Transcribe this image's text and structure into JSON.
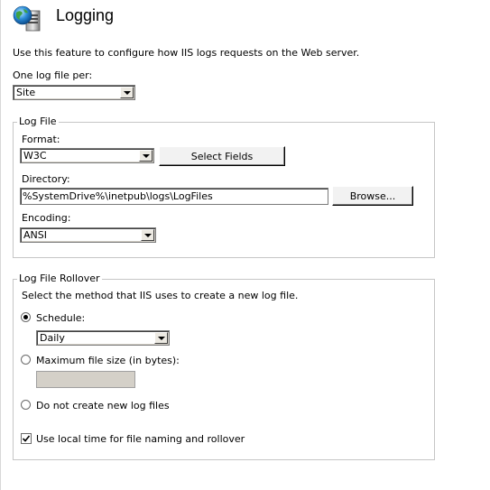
{
  "header": {
    "title": "Logging",
    "icon": "globe-server-icon"
  },
  "description": "Use this feature to configure how IIS logs requests on the Web server.",
  "log_file_per": {
    "label": "One log file per:",
    "value": "Site"
  },
  "log_file_group": {
    "legend": "Log File",
    "format": {
      "label": "Format:",
      "value": "W3C"
    },
    "select_fields_label": "Select Fields",
    "directory": {
      "label": "Directory:",
      "value": "%SystemDrive%\\inetpub\\logs\\LogFiles"
    },
    "browse_label": "Browse...",
    "encoding": {
      "label": "Encoding:",
      "value": "ANSI"
    }
  },
  "rollover_group": {
    "legend": "Log File Rollover",
    "instruction": "Select the method that IIS uses to create a new log file.",
    "schedule": {
      "label": "Schedule:",
      "selected": true,
      "value": "Daily"
    },
    "max_size": {
      "label": "Maximum file size (in bytes):",
      "selected": false,
      "value": ""
    },
    "no_new": {
      "label": "Do not create new log files",
      "selected": false
    },
    "local_time": {
      "label": "Use local time for file naming and rollover",
      "checked": true
    }
  }
}
